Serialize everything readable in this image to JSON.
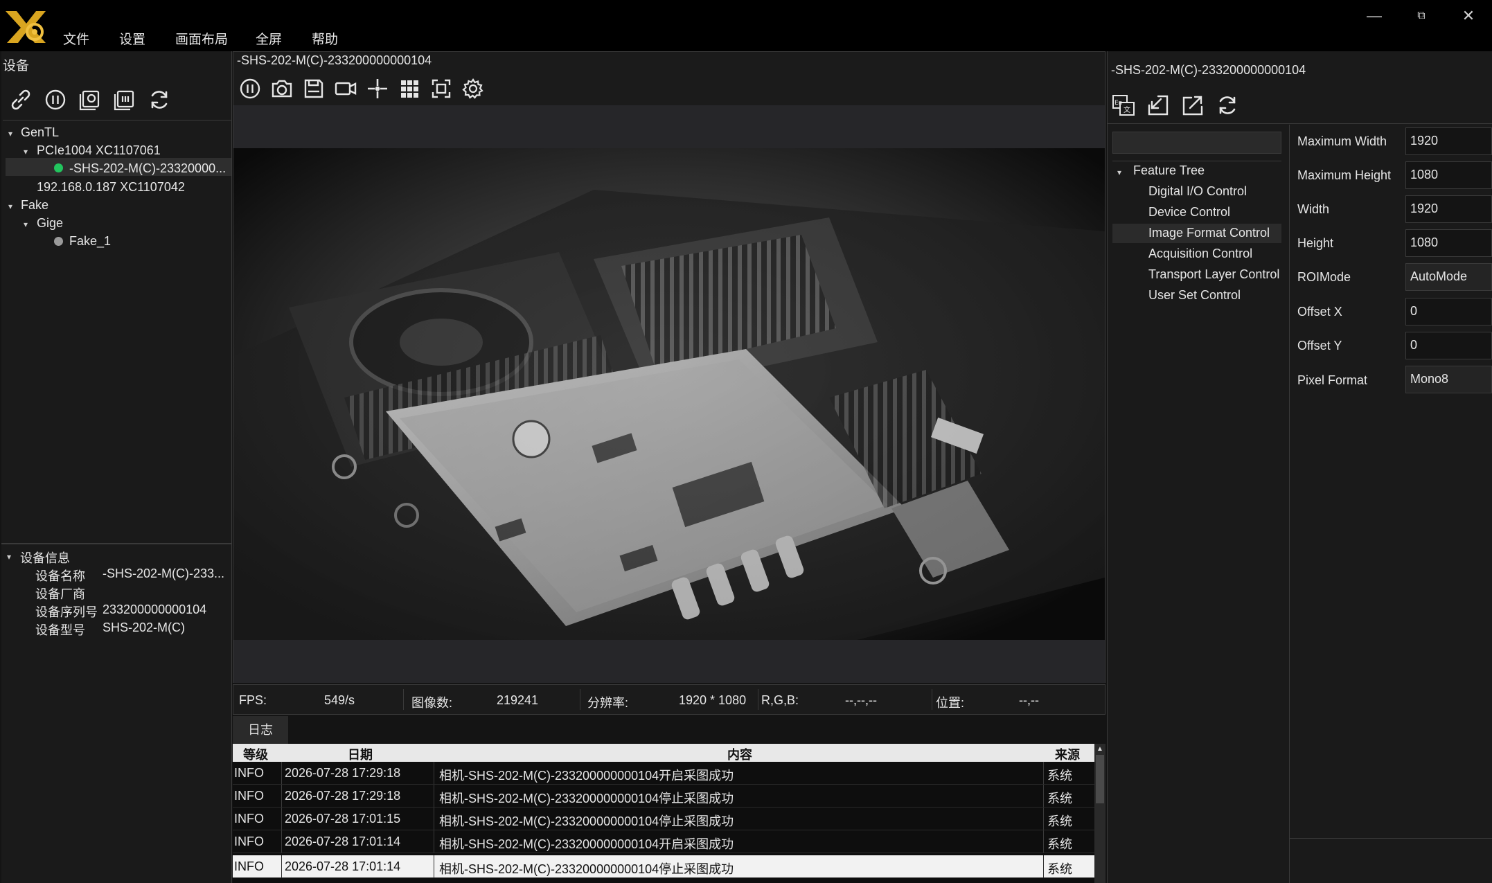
{
  "titlebar": {
    "menus": [
      "文件",
      "设置",
      "画面布局",
      "全屏",
      "帮助"
    ],
    "window_controls": [
      "minimize-icon",
      "restore-icon",
      "close-icon"
    ]
  },
  "left": {
    "title": "设备",
    "toolbar_icons": [
      "link-icon",
      "pause-circle-icon",
      "capture-history-icon",
      "record-history-icon",
      "refresh-icon"
    ],
    "tree": [
      {
        "label": "GenTL",
        "level": 0,
        "expanded": true
      },
      {
        "label": "PCIe1004 XC1107061",
        "level": 1,
        "expanded": true
      },
      {
        "label": "-SHS-202-M(C)-23320000...",
        "level": 2,
        "status": "green",
        "selected": true
      },
      {
        "label": "192.168.0.187 XC1107042",
        "level": 1
      },
      {
        "label": "Fake",
        "level": 0,
        "expanded": true
      },
      {
        "label": "Gige",
        "level": 1,
        "expanded": true
      },
      {
        "label": "Fake_1",
        "level": 2,
        "status": "gray"
      }
    ],
    "info": {
      "title": "设备信息",
      "rows": [
        {
          "k": "设备名称",
          "v": "-SHS-202-M(C)-233..."
        },
        {
          "k": "设备厂商",
          "v": ""
        },
        {
          "k": "设备序列号",
          "v": "233200000000104"
        },
        {
          "k": "设备型号",
          "v": "SHS-202-M(C)"
        }
      ]
    }
  },
  "viewer": {
    "title": "-SHS-202-M(C)-233200000000104",
    "toolbar_icons": [
      "pause-icon",
      "camera-icon",
      "save-icon",
      "video-icon",
      "crosshair-icon",
      "grid-icon",
      "fit-screen-icon",
      "gear-icon"
    ]
  },
  "status": {
    "fps_label": "FPS:",
    "fps_value": "549/s",
    "count_label": "图像数:",
    "count_value": "219241",
    "res_label": "分辨率:",
    "res_value": "1920 * 1080",
    "rgb_label": "R,G,B:",
    "rgb_value": "--,--,--",
    "pos_label": "位置:",
    "pos_value": "--,--"
  },
  "log": {
    "tab": "日志",
    "headers": {
      "level": "等级",
      "date": "日期",
      "content": "内容",
      "source": "来源"
    },
    "rows": [
      {
        "level": "INFO",
        "date": "2026-07-28 17:29:18",
        "content": "相机-SHS-202-M(C)-233200000000104开启采图成功",
        "source": "系统"
      },
      {
        "level": "INFO",
        "date": "2026-07-28 17:29:18",
        "content": "相机-SHS-202-M(C)-233200000000104停止采图成功",
        "source": "系统"
      },
      {
        "level": "INFO",
        "date": "2026-07-28 17:01:15",
        "content": "相机-SHS-202-M(C)-233200000000104停止采图成功",
        "source": "系统"
      },
      {
        "level": "INFO",
        "date": "2026-07-28 17:01:14",
        "content": "相机-SHS-202-M(C)-233200000000104开启采图成功",
        "source": "系统"
      },
      {
        "level": "INFO",
        "date": "2026-07-28 17:01:14",
        "content": "相机-SHS-202-M(C)-233200000000104停止采图成功",
        "source": "系统"
      }
    ]
  },
  "right": {
    "title": "-SHS-202-M(C)-233200000000104",
    "toolbar_icons": [
      "language-icon",
      "import-icon",
      "export-icon",
      "refresh-icon"
    ],
    "tree_root": "Feature Tree",
    "tree_items": [
      "Digital I/O Control",
      "Device Control",
      "Image Format Control",
      "Acquisition Control",
      "Transport Layer Control",
      "User Set Control"
    ],
    "selected_item": "Image Format Control",
    "params": [
      {
        "label": "Maximum Width",
        "value": "1920"
      },
      {
        "label": "Maximum Height",
        "value": "1080"
      },
      {
        "label": "Width",
        "value": "1920"
      },
      {
        "label": "Height",
        "value": "1080"
      },
      {
        "label": "ROIMode",
        "value": "AutoMode"
      },
      {
        "label": "Offset X",
        "value": "0"
      },
      {
        "label": "Offset Y",
        "value": "0"
      },
      {
        "label": "Pixel Format",
        "value": "Mono8"
      }
    ]
  },
  "colors": {
    "accent": "#d9a520",
    "status_green": "#22c55e",
    "status_gray": "#9a9a9a"
  }
}
